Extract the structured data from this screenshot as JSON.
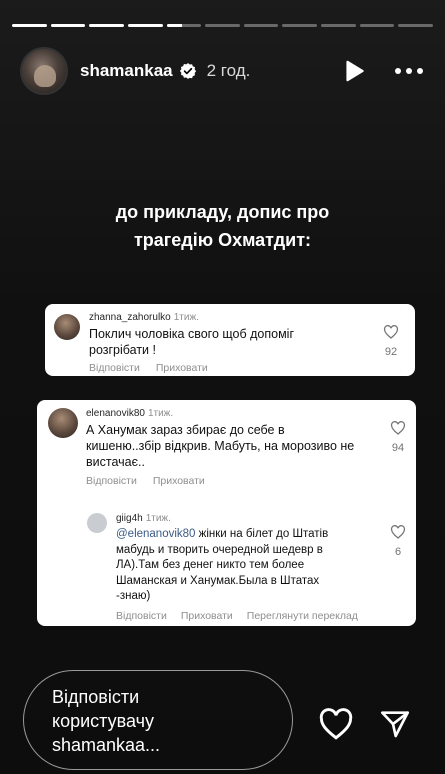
{
  "progress": {
    "segments": 11,
    "completed": 4,
    "current_fraction": 0.45
  },
  "header": {
    "username": "shamankaa",
    "time": "2 год."
  },
  "caption": {
    "line1": "до прикладу, допис про",
    "line2": "трагедію Охматдит:"
  },
  "comment1": {
    "username": "zhanna_zahorulko",
    "time": "1тиж.",
    "text_line1": "Поклич чоловіка свого щоб допоміг",
    "text_line2": "розгрібати !",
    "likes": "92",
    "reply": "Відповісти",
    "hide": "Приховати"
  },
  "comment2": {
    "username": "elenanovik80",
    "time": "1тиж.",
    "text_line1": "А Ханумак зараз збирає до себе в",
    "text_line2": "кишеню..збір відкрив. Мабуть, на морозиво не",
    "text_line3": "вистачає..",
    "likes": "94",
    "reply": "Відповісти",
    "hide": "Приховати"
  },
  "comment3": {
    "username": "giig4h",
    "time": "1тиж.",
    "mention": "@elenanovik80",
    "text_line1_rest": " жінки на білет до Штатів",
    "text_line2": "мабудь и творить очередной шедевр в",
    "text_line3": "ЛА).Там без денег никто тем более",
    "text_line4": "Шаманская и Ханумак.Была в Штатах",
    "text_line5": "-знаю)",
    "likes": "6",
    "reply": "Відповісти",
    "hide": "Приховати",
    "translate": "Переглянути переклад"
  },
  "footer": {
    "reply_line1": "Відповісти",
    "reply_line2": "користувачу",
    "reply_line3": "shamankaa..."
  },
  "icons": {
    "verified": "verified-badge-icon",
    "play": "play-icon",
    "more": "more-options-icon",
    "heart": "heart-icon",
    "send": "send-icon"
  },
  "colors": {
    "background": "#000000",
    "mention": "#3b5b86",
    "verified": "#ffffff"
  }
}
